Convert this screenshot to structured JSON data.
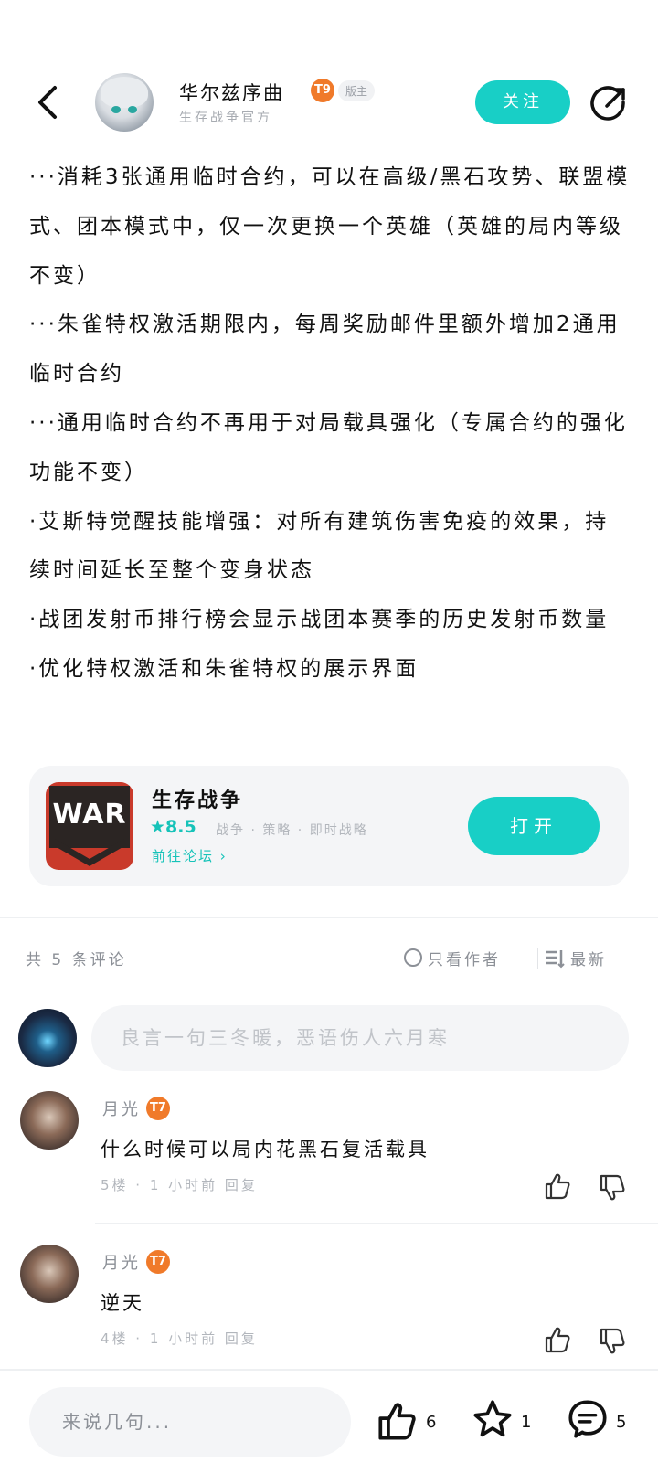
{
  "header": {
    "author_name": "华尔兹序曲",
    "author_level": "9",
    "role_tag": "版主",
    "author_subtitle": "生存战争官方",
    "follow_label": "关注"
  },
  "post": {
    "paragraphs": [
      "···消耗3张通用临时合约，可以在高级/黑石攻势、联盟模式、团本模式中，仅一次更换一个英雄（英雄的局内等级不变）",
      "···朱雀特权激活期限内，每周奖励邮件里额外增加2通用临时合约",
      "···通用临时合约不再用于对局载具强化（专属合约的强化功能不变）",
      "·艾斯特觉醒技能增强：对所有建筑伤害免疫的效果，持续时间延长至整个变身状态",
      "·战团发射币排行榜会显示战团本赛季的历史发射币数量",
      "·优化特权激活和朱雀特权的展示界面"
    ]
  },
  "game_card": {
    "icon_text": "WAR",
    "name": "生存战争",
    "rating": "8.5",
    "tags": "战争 · 策略 · 即时战略",
    "forum_link": "前往论坛",
    "open_label": "打开"
  },
  "comments_header": {
    "count_label": "共 5 条评论",
    "author_only_label": "只看作者",
    "sort_label": "最新"
  },
  "comment_input": {
    "placeholder": "良言一句三冬暖，恶语伤人六月寒"
  },
  "comments": [
    {
      "user": "月光",
      "level": "7",
      "text": "什么时候可以局内花黑石复活载具",
      "meta": "5楼 · 1 小时前  回复"
    },
    {
      "user": "月光",
      "level": "7",
      "text": "逆天",
      "meta": "4楼 · 1 小时前  回复"
    }
  ],
  "bottom_bar": {
    "reply_placeholder": "来说几句...",
    "like_count": "6",
    "star_count": "1",
    "comment_count": "5"
  },
  "colors": {
    "accent": "#18cfc6",
    "level_badge": "#f07a2a",
    "muted_text": "#8c9097"
  }
}
